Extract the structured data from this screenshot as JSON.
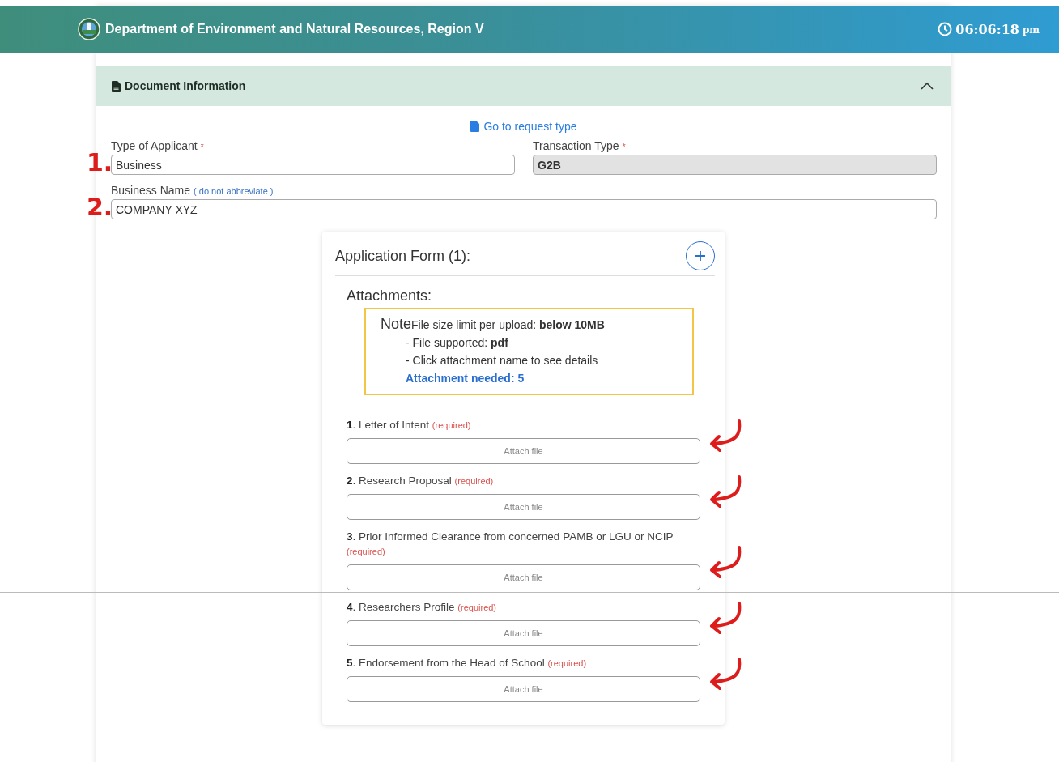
{
  "header": {
    "title": "Department of Environment and Natural Resources, Region V",
    "time": "06:06:18",
    "time_suffix": "pm"
  },
  "section": {
    "title": "Document Information",
    "expanded": true
  },
  "request_link": "Go to request type",
  "fields": [
    {
      "label": "Type of Applicant",
      "required_mark": "*",
      "value": "Business",
      "disabled": false,
      "annotation": "1."
    },
    {
      "label": "Transaction Type",
      "required_mark": "*",
      "value": "G2B",
      "disabled": true
    }
  ],
  "business_name": {
    "label": "Business Name",
    "hint": "( do not abbreviate )",
    "value": "COMPANY XYZ",
    "annotation": "2."
  },
  "form": {
    "title": "Application Form (1):",
    "attachments_title": "Attachments:",
    "note": {
      "label": "Note",
      "lines": [
        "File size limit per upload: **below 10MB**",
        "- File supported: **pdf**",
        "- Click attachment name to see details"
      ],
      "needed": "Attachment needed: 5"
    },
    "attachments": [
      {
        "name": "**1**. Letter of Intent",
        "tag": "(required)",
        "button": "Attach file",
        "marked": true
      },
      {
        "name": "**2**. Research Proposal",
        "tag": "(required)",
        "button": "Attach file",
        "marked": true
      },
      {
        "name": "**3**. Prior Informed Clearance from concerned PAMB or LGU or NCIP",
        "tag": "(required)",
        "button": "Attach file",
        "marked": true
      },
      {
        "name": "**4**. Researchers Profile",
        "tag": "(required)",
        "button": "Attach file",
        "marked": true
      },
      {
        "name": "**5**. Endorsement from the Head of School",
        "tag": "(required)",
        "button": "Attach file",
        "marked": true
      }
    ]
  }
}
